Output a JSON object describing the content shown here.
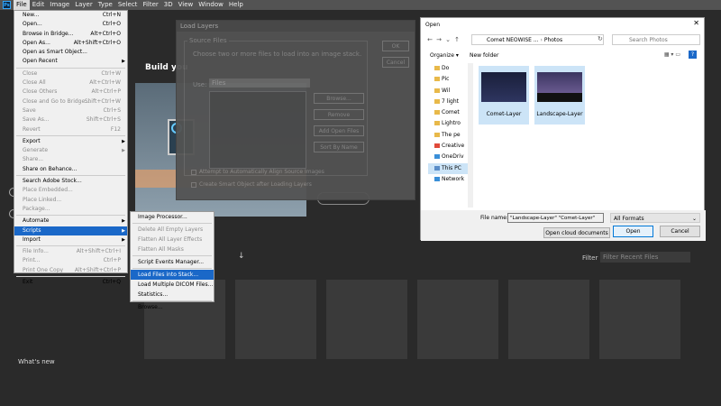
{
  "menubar": {
    "logo": "Ps",
    "items": [
      "File",
      "Edit",
      "Image",
      "Layer",
      "Type",
      "Select",
      "Filter",
      "3D",
      "View",
      "Window",
      "Help"
    ]
  },
  "home": {
    "heading": "Build you",
    "filter_label": "Filter",
    "filter_placeholder": "Filter Recent Files",
    "whats_new": "What's new",
    "sort_icon": "down-arrow"
  },
  "file_menu": {
    "items": [
      {
        "label": "New...",
        "shortcut": "Ctrl+N"
      },
      {
        "label": "Open...",
        "shortcut": "Ctrl+O"
      },
      {
        "label": "Browse in Bridge...",
        "shortcut": "Alt+Ctrl+O"
      },
      {
        "label": "Open As...",
        "shortcut": "Alt+Shift+Ctrl+O"
      },
      {
        "label": "Open as Smart Object...",
        "shortcut": ""
      },
      {
        "label": "Open Recent",
        "shortcut": "",
        "submenu": true
      },
      {
        "label": "Close",
        "shortcut": "Ctrl+W",
        "disabled": true
      },
      {
        "label": "Close All",
        "shortcut": "Alt+Ctrl+W",
        "disabled": true
      },
      {
        "label": "Close Others",
        "shortcut": "Alt+Ctrl+P",
        "disabled": true
      },
      {
        "label": "Close and Go to Bridge...",
        "shortcut": "Shift+Ctrl+W",
        "disabled": true
      },
      {
        "label": "Save",
        "shortcut": "Ctrl+S",
        "disabled": true
      },
      {
        "label": "Save As...",
        "shortcut": "Shift+Ctrl+S",
        "disabled": true
      },
      {
        "label": "Revert",
        "shortcut": "F12",
        "disabled": true
      },
      {
        "label": "Export",
        "shortcut": "",
        "submenu": true
      },
      {
        "label": "Generate",
        "shortcut": "",
        "submenu": true,
        "disabled": true
      },
      {
        "label": "Share...",
        "shortcut": "",
        "disabled": true
      },
      {
        "label": "Share on Behance...",
        "shortcut": ""
      },
      {
        "label": "Search Adobe Stock...",
        "shortcut": ""
      },
      {
        "label": "Place Embedded...",
        "shortcut": "",
        "disabled": true
      },
      {
        "label": "Place Linked...",
        "shortcut": "",
        "disabled": true
      },
      {
        "label": "Package...",
        "shortcut": "",
        "disabled": true
      },
      {
        "label": "Automate",
        "shortcut": "",
        "submenu": true
      },
      {
        "label": "Scripts",
        "shortcut": "",
        "submenu": true,
        "highlighted": true
      },
      {
        "label": "Import",
        "shortcut": "",
        "submenu": true
      },
      {
        "label": "File Info...",
        "shortcut": "Alt+Shift+Ctrl+I",
        "disabled": true
      },
      {
        "label": "Print...",
        "shortcut": "Ctrl+P",
        "disabled": true
      },
      {
        "label": "Print One Copy",
        "shortcut": "Alt+Shift+Ctrl+P",
        "disabled": true
      },
      {
        "label": "Exit",
        "shortcut": "Ctrl+Q"
      }
    ]
  },
  "scripts_menu": {
    "items": [
      {
        "label": "Image Processor..."
      },
      {
        "label": "Delete All Empty Layers",
        "disabled": true
      },
      {
        "label": "Flatten All Layer Effects",
        "disabled": true
      },
      {
        "label": "Flatten All Masks",
        "disabled": true
      },
      {
        "label": "Script Events Manager..."
      },
      {
        "label": "Load Files into Stack...",
        "highlighted": true
      },
      {
        "label": "Load Multiple DICOM Files..."
      },
      {
        "label": "Statistics..."
      },
      {
        "label": "Browse..."
      }
    ]
  },
  "load_layers": {
    "title": "Load Layers",
    "group_label": "Source Files",
    "description": "Choose two or more files to load into an image stack.",
    "use_label": "Use:",
    "use_value": "Files",
    "browse": "Browse...",
    "remove": "Remove",
    "add_open": "Add Open Files",
    "sort_name": "Sort By Name",
    "ok": "OK",
    "cancel": "Cancel",
    "align_label": "Attempt to Automatically Align Source Images",
    "smart_label": "Create Smart Object after Loading Layers"
  },
  "open_dialog": {
    "title": "Open",
    "address": [
      "Comet NEOWISE ...",
      "Photos"
    ],
    "search_placeholder": "Search Photos",
    "organize": "Organize",
    "new_folder": "New folder",
    "tree": [
      {
        "label": "Do",
        "icon": "folder"
      },
      {
        "label": "Pic",
        "icon": "folder"
      },
      {
        "label": "Wil",
        "icon": "folder"
      },
      {
        "label": "7 light",
        "icon": "folder"
      },
      {
        "label": "Comet",
        "icon": "folder"
      },
      {
        "label": "Lightro",
        "icon": "folder"
      },
      {
        "label": "The pe",
        "icon": "folder"
      },
      {
        "label": "Creative",
        "icon": "creative-cloud"
      },
      {
        "label": "OneDriv",
        "icon": "onedrive"
      },
      {
        "label": "This PC",
        "icon": "pc",
        "selected": true
      },
      {
        "label": "Network",
        "icon": "network"
      }
    ],
    "files": [
      {
        "name": "Comet-Layer"
      },
      {
        "name": "Landscape-Layer"
      }
    ],
    "filename_label": "File name:",
    "filename_value": "\"Landscape-Layer\" \"Comet-Layer\"",
    "filetype_value": "All Formats",
    "open_cloud": "Open cloud documents",
    "open": "Open",
    "cancel": "Cancel"
  }
}
